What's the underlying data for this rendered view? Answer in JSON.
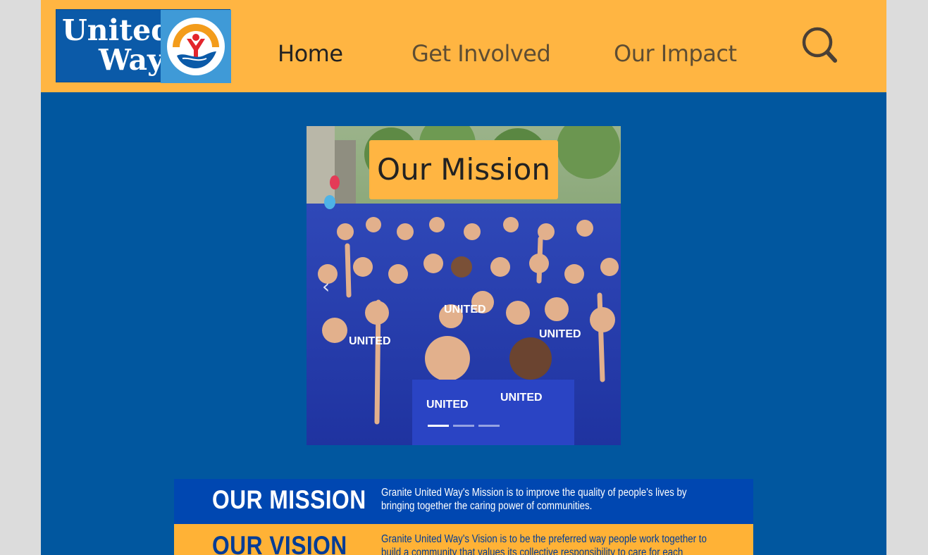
{
  "header": {
    "logo": {
      "line1": "United",
      "line2": "Way",
      "alt": "United Way logo"
    },
    "nav": [
      {
        "label": "Home",
        "active": true
      },
      {
        "label": "Get Involved",
        "active": false
      },
      {
        "label": "Our Impact",
        "active": false
      }
    ],
    "search_icon": "search-icon"
  },
  "carousel": {
    "caption": "Our Mission",
    "prev_icon": "chevron-left-icon",
    "prev_glyph": "‹",
    "slide_count": 3,
    "active_slide": 1
  },
  "mission_vision": {
    "mission": {
      "heading": "OUR MISSION",
      "text": "Granite United Way's Mission is to improve the quality of people's lives by bringing together the caring power of communities."
    },
    "vision": {
      "heading": "OUR VISION",
      "text": "Granite United Way's Vision is to be the preferred way people work together to build a community that values its collective responsibility to care for each other."
    }
  },
  "colors": {
    "header_bg": "#ffb542",
    "page_bg": "#01579f",
    "logo_blue": "#0b5aa8",
    "mission_band": "#0047b1",
    "vision_band": "#ffb236"
  }
}
